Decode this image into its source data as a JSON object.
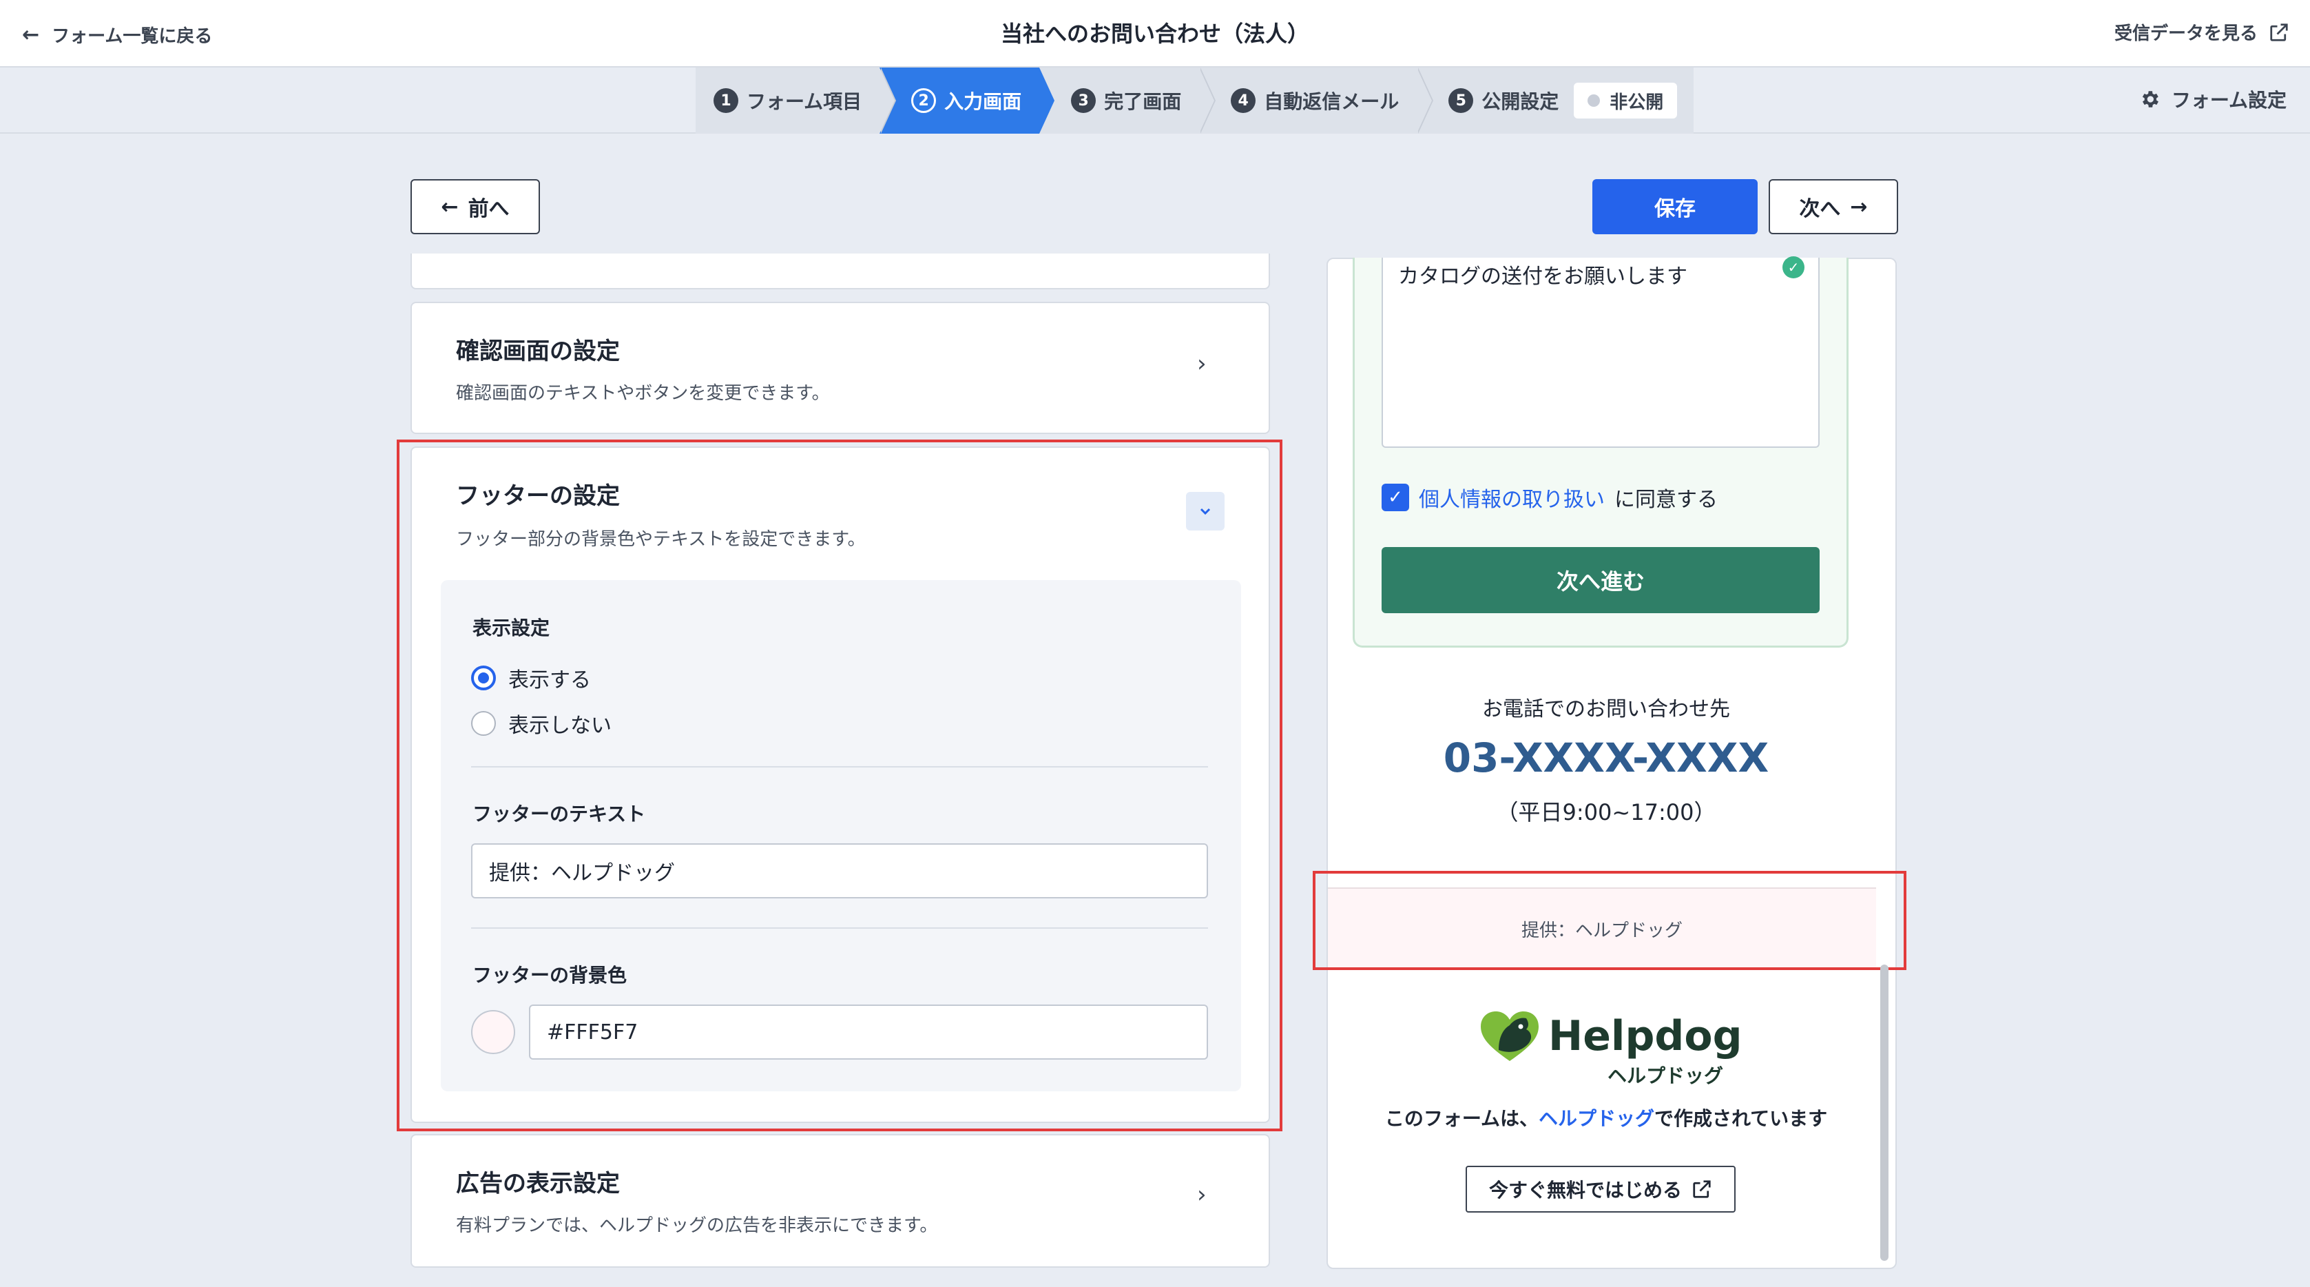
{
  "header": {
    "back_label": "フォーム一覧に戻る",
    "title": "当社へのお問い合わせ（法人）",
    "view_data_label": "受信データを見る"
  },
  "steps": [
    {
      "num": "1",
      "label": "フォーム項目"
    },
    {
      "num": "2",
      "label": "入力画面",
      "active": true
    },
    {
      "num": "3",
      "label": "完了画面"
    },
    {
      "num": "4",
      "label": "自動返信メール"
    },
    {
      "num": "5",
      "label": "公開設定"
    }
  ],
  "publish_status": "非公開",
  "form_settings_label": "フォーム設定",
  "nav": {
    "prev_label": "前へ",
    "save_label": "保存",
    "next_label": "次へ"
  },
  "cards": {
    "confirm": {
      "title": "確認画面の設定",
      "desc": "確認画面のテキストやボタンを変更できます。"
    },
    "footer": {
      "title": "フッターの設定",
      "desc": "フッター部分の背景色やテキストを設定できます。"
    },
    "ads": {
      "title": "広告の表示設定",
      "desc": "有料プランでは、ヘルプドッグの広告を非表示にできます。"
    }
  },
  "footer_settings": {
    "display_label": "表示設定",
    "option_show": "表示する",
    "option_hide": "表示しない",
    "selected": "表示する",
    "text_label": "フッターのテキスト",
    "text_value": "提供：ヘルプドッグ",
    "bg_label": "フッターの背景色",
    "bg_value": "#FFF5F7"
  },
  "preview": {
    "textarea_value": "カタログの送付をお願いします",
    "agree_link": "個人情報の取り扱い",
    "agree_suffix": "に同意する",
    "proceed_label": "次へ進む",
    "phone_label": "お電話でのお問い合わせ先",
    "phone_number": "03-XXXX-XXXX",
    "phone_hours": "（平日9:00~17:00）",
    "footer_text": "提供：ヘルプドッグ",
    "logo_text": "Helpdog",
    "logo_sub": "ヘルプドッグ",
    "made_by_prefix": "このフォームは、",
    "made_by_link": "ヘルプドッグ",
    "made_by_suffix": "で作成されています",
    "start_label": "今すぐ無料ではじめる"
  },
  "colors": {
    "accent": "#2563eb",
    "step_active": "#2e7ae8",
    "proceed_button": "#2f7f67",
    "footer_bg": "#FFF5F7",
    "highlight": "#e23b3b"
  }
}
